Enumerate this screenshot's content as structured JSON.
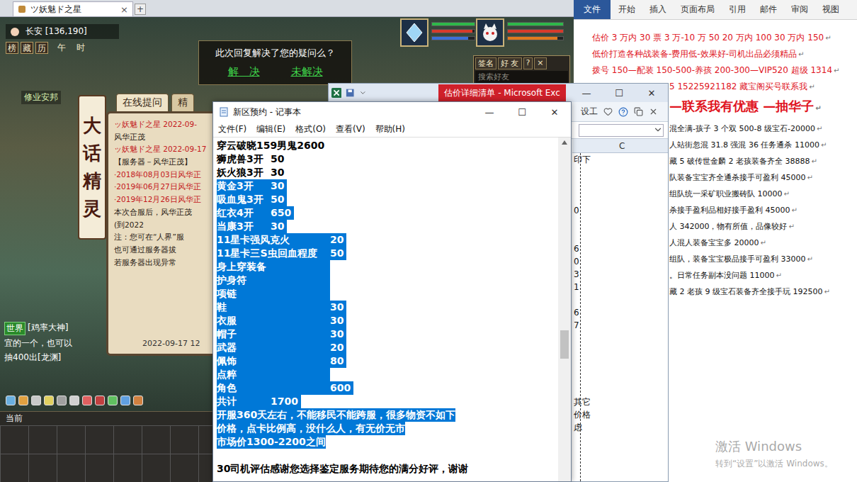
{
  "game": {
    "tab_title": "ツ妖魅ド之星",
    "tab_close": "×",
    "tab_add": "+",
    "location": "长安 [136,190]",
    "quick_buttons": [
      {
        "label": "榜",
        "kind": "button"
      },
      {
        "label": "藏",
        "kind": "button"
      },
      {
        "label": "历",
        "kind": "button"
      },
      {
        "label": "午",
        "kind": "text"
      },
      {
        "label": "时",
        "kind": "text"
      }
    ],
    "place": "修业安邦",
    "feedback": {
      "question": "此次回复解决了您的疑问么？",
      "buttons": [
        "解　决",
        "未解决"
      ]
    },
    "portraits": [
      {
        "bars": [
          {
            "level": 1,
            "color": "#2fb84a"
          },
          {
            "level": 0.95,
            "color": "#d83a2a"
          },
          {
            "level": 0.85,
            "color": "#3b6fd8"
          }
        ]
      },
      {
        "bars": [
          {
            "level": 1,
            "color": "#2fb84a"
          },
          {
            "level": 1,
            "color": "#d83a2a"
          },
          {
            "level": 0.9,
            "color": "#e07a1e"
          }
        ]
      }
    ],
    "friends": {
      "buttons": [
        "签名",
        "好 友",
        "?",
        "×"
      ],
      "search": "搜索好友"
    },
    "sprite": {
      "title": "大话精灵",
      "tabs": [
        {
          "label": "在线提问",
          "selected": true
        },
        {
          "label": "精",
          "selected": false
        }
      ],
      "lines": [
        {
          "text": "ッ妖魅ド之星 2022-09-",
          "kind": "red"
        },
        {
          "text": "风华正茂",
          "kind": "dark"
        },
        {
          "text": "ッ妖魅ド之星 2022-09-17",
          "kind": "red"
        },
        {
          "text": "【服务器－风华正茂】",
          "kind": "dark"
        },
        {
          "text": "·2018年08月03日风华正",
          "kind": "red"
        },
        {
          "text": "·2019年06月27日风华正",
          "kind": "red"
        },
        {
          "text": "·2019年12月26日风华正",
          "kind": "red"
        },
        {
          "text": "本次合服后，风华正茂",
          "kind": "dark"
        },
        {
          "text": "(到2022",
          "kind": "dark"
        },
        {
          "text": "注：您可在“人界”服",
          "kind": "dark"
        },
        {
          "text": "也可通过服务器拔",
          "kind": "dark"
        },
        {
          "text": "若服务器出现异常",
          "kind": "dark"
        }
      ],
      "time": "2022-09-17 12"
    },
    "chat": {
      "channel": "世界",
      "lines": [
        "[鸡率大神]",
        "宜的一个，也可以",
        "抽400出[龙渊]"
      ]
    },
    "input_label": "当前"
  },
  "notepad": {
    "title": "新区预约 - 记事本",
    "controls": [
      "—",
      "☐",
      "✕"
    ],
    "menu": [
      "文件(F)",
      "编辑(E)",
      "格式(O)",
      "查看(V)",
      "帮助(H)"
    ],
    "lines": [
      {
        "name": "穿云破晓159男鬼2600",
        "value": "",
        "kind": "text",
        "selected": false
      },
      {
        "name": "狮虎兽3开",
        "value": "50",
        "kind": "short",
        "selected": false
      },
      {
        "name": "妖火狼3开",
        "value": "30",
        "kind": "short",
        "selected": false
      },
      {
        "name": "黄金3开",
        "value": "30",
        "kind": "short",
        "selected": true
      },
      {
        "name": "吸血鬼3开",
        "value": "50",
        "kind": "short",
        "selected": true
      },
      {
        "name": "红衣4开",
        "value": "650",
        "kind": "short",
        "selected": true
      },
      {
        "name": "当康3开",
        "value": "30",
        "kind": "short",
        "selected": true
      },
      {
        "name": "11星卡强风克火",
        "value": "20",
        "kind": "wide",
        "selected": true
      },
      {
        "name": "11星卡三S虫回血程度",
        "value": "50",
        "kind": "wide",
        "selected": true
      },
      {
        "name": "身上穿装备",
        "value": "",
        "kind": "wide",
        "selected": true
      },
      {
        "name": "护身符",
        "value": "",
        "kind": "wide",
        "selected": true
      },
      {
        "name": "项链",
        "value": "",
        "kind": "wide",
        "selected": true
      },
      {
        "name": "鞋",
        "value": "30",
        "kind": "wide",
        "selected": true
      },
      {
        "name": "衣服",
        "value": "30",
        "kind": "wide",
        "selected": true
      },
      {
        "name": "帽子",
        "value": "30",
        "kind": "wide",
        "selected": true
      },
      {
        "name": "武器",
        "value": "20",
        "kind": "wide",
        "selected": true
      },
      {
        "name": "佩饰",
        "value": "80",
        "kind": "wide",
        "selected": true
      },
      {
        "name": "点粹",
        "value": "",
        "kind": "wide",
        "selected": true
      },
      {
        "name": "角色",
        "value": "600",
        "kind": "wide",
        "selected": true
      },
      {
        "name": "共计",
        "value": "1700",
        "kind": "short",
        "selected": true
      },
      {
        "name": "开服360天左右，不能移民不能跨服，很多物资不如下",
        "value": "",
        "kind": "text",
        "selected": true
      },
      {
        "name": "价格，点卡比例高，没什么人，有无价无市",
        "value": "",
        "kind": "text",
        "selected": true
      },
      {
        "name": "市场价1300-2200之间",
        "value": "",
        "kind": "text",
        "selected": true
      },
      {
        "name": "",
        "value": "",
        "kind": "text",
        "selected": false
      },
      {
        "name": "30司机评估感谢您选择鉴定服务期待您的满分好评，谢谢",
        "value": "",
        "kind": "text",
        "selected": false
      }
    ]
  },
  "excel": {
    "title": "估价详细清单 - Microsoft Exc",
    "controls": [
      "—",
      "☐",
      "✕"
    ],
    "toolbar_text": "设工",
    "column": "C",
    "cells": [
      "印下",
      "",
      "",
      "",
      "0",
      "",
      "",
      "6",
      "0",
      "3",
      "1",
      "",
      "6",
      "7",
      "",
      "",
      "",
      "",
      "",
      "其它",
      "价格",
      "虑"
    ]
  },
  "word": {
    "tabs": [
      {
        "label": "文件",
        "selected": true
      },
      {
        "label": "开始",
        "selected": false
      },
      {
        "label": "插入",
        "selected": false
      },
      {
        "label": "页面布局",
        "selected": false
      },
      {
        "label": "引用",
        "selected": false
      },
      {
        "label": "邮件",
        "selected": false
      },
      {
        "label": "审阅",
        "selected": false
      },
      {
        "label": "视图",
        "selected": false
      }
    ],
    "para_mark": "↵",
    "lines": [
      {
        "text": "估价 3 万内 30 票 3 万-10 万 50 20 万内 100 30 万内 150",
        "kind": "red"
      },
      {
        "text": "低价打造各种战装备-费用低-效果好-司机出品必须精品",
        "kind": "red"
      },
      {
        "text": "拨号 150—配装 150-500-养孩 200-300—VIP520 超级 1314",
        "kind": "red"
      },
      {
        "text": "5  15225921182  藏宝阁买号联系我",
        "kind": "clipped-red"
      },
      {
        "text": "—联系我有优惠 —抽华子",
        "kind": "big"
      },
      {
        "text": "混全满-孩子 3 个双 500-8 级宝石-20000",
        "kind": "black"
      },
      {
        "text": "人站街忽混 31.8 强混 36 任务通杀 11000",
        "kind": "black"
      },
      {
        "text": "藏 5 破传世金麟 2 老孩装备齐全 38888",
        "kind": "black"
      },
      {
        "text": "队装备宝宝齐全通杀接手可盈利 45000",
        "kind": "black"
      },
      {
        "text": "组队统一采矿职业搬砖队 10000",
        "kind": "black"
      },
      {
        "text": "杀接手盈利品相好接手盈利 45000",
        "kind": "black"
      },
      {
        "text": "人 342000，物有所值，品像较好",
        "kind": "black"
      },
      {
        "text": "人混人装备宝宝多 20000",
        "kind": "black"
      },
      {
        "text": "组队，装备宝宝极品接手可盈利 33000",
        "kind": "black"
      },
      {
        "text": "。日常任务副本没问题 11000",
        "kind": "black"
      },
      {
        "text": "藏 2 老孩 9 级宝石装备齐全接手玩 192500",
        "kind": "black"
      }
    ]
  },
  "watermark": {
    "line1": "激活 Windows",
    "line2": "转到“设置”以激活 Windows。"
  }
}
